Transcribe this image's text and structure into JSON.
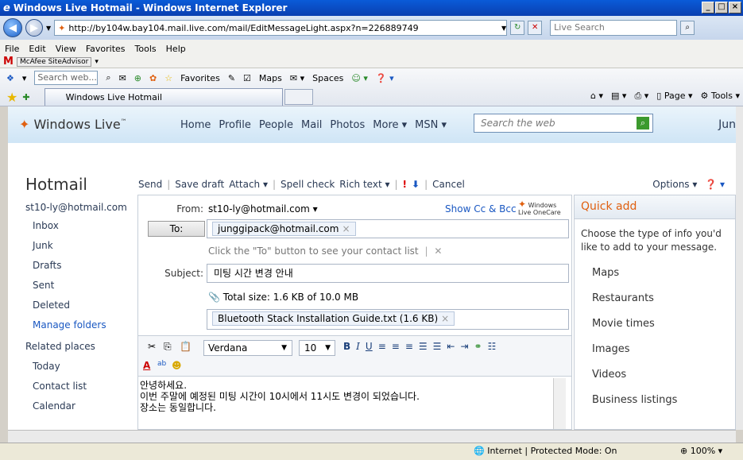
{
  "window": {
    "title": "Windows Live Hotmail - Windows Internet Explorer",
    "min": "_",
    "max": "□",
    "close": "×"
  },
  "address": {
    "url": "http://by104w.bay104.mail.live.com/mail/EditMessageLight.aspx?n=226889749",
    "search_placeholder": "Live Search"
  },
  "menu": [
    "File",
    "Edit",
    "View",
    "Favorites",
    "Tools",
    "Help"
  ],
  "mcafee": "McAfee SiteAdvisor",
  "links_toolbar": {
    "search_placeholder": "Search web...",
    "favorites": "Favorites",
    "maps": "Maps",
    "spaces": "Spaces"
  },
  "tab": {
    "title": "Windows Live Hotmail",
    "page_menu": "Page",
    "tools_menu": "Tools"
  },
  "live_header": {
    "logo": "Windows Live",
    "logo_tm": "™",
    "nav": [
      "Home",
      "Profile",
      "People",
      "Mail",
      "Photos",
      "More ▾",
      "MSN ▾"
    ],
    "search_placeholder": "Search the web",
    "user": "Jun"
  },
  "hotmail": {
    "title": "Hotmail",
    "commands": {
      "send": "Send",
      "save_draft": "Save draft",
      "attach": "Attach ▾",
      "spell_check": "Spell check",
      "rich_text": "Rich text ▾",
      "cancel": "Cancel"
    },
    "options": "Options ▾"
  },
  "left_nav": {
    "account": "st10-ly@hotmail.com",
    "folders": [
      "Inbox",
      "Junk",
      "Drafts",
      "Sent",
      "Deleted"
    ],
    "manage": "Manage folders",
    "related_title": "Related places",
    "related": [
      "Today",
      "Contact list",
      "Calendar"
    ]
  },
  "compose": {
    "from_label": "From:",
    "from_value": "st10-ly@hotmail.com ▾",
    "show_cc": "Show Cc & Bcc",
    "onecare": "Windows Live OneCare",
    "to_button": "To:",
    "to_recipient": "junggipack@hotmail.com",
    "to_hint": "Click the \"To\" button to see your contact list",
    "subject_label": "Subject:",
    "subject_value": "미팅 시간 변경 안내",
    "total_size": "Total size: 1.6 KB of 10.0 MB",
    "attachment": "Bluetooth Stack Installation Guide.txt  (1.6 KB)",
    "font": "Verdana",
    "font_size": "10",
    "body_lines": [
      "안녕하세요.",
      "이번 주말에 예정된 미팅 시간이 10시에서 11시도 변경이 되었습니다.",
      "장소는 동일합니다."
    ]
  },
  "quick_add": {
    "title": "Quick add",
    "description": "Choose the type of info you'd like to add to your message.",
    "items": [
      "Maps",
      "Restaurants",
      "Movie times",
      "Images",
      "Videos",
      "Business listings"
    ]
  },
  "status": {
    "zone": "Internet | Protected Mode: On",
    "zoom": "100%"
  }
}
